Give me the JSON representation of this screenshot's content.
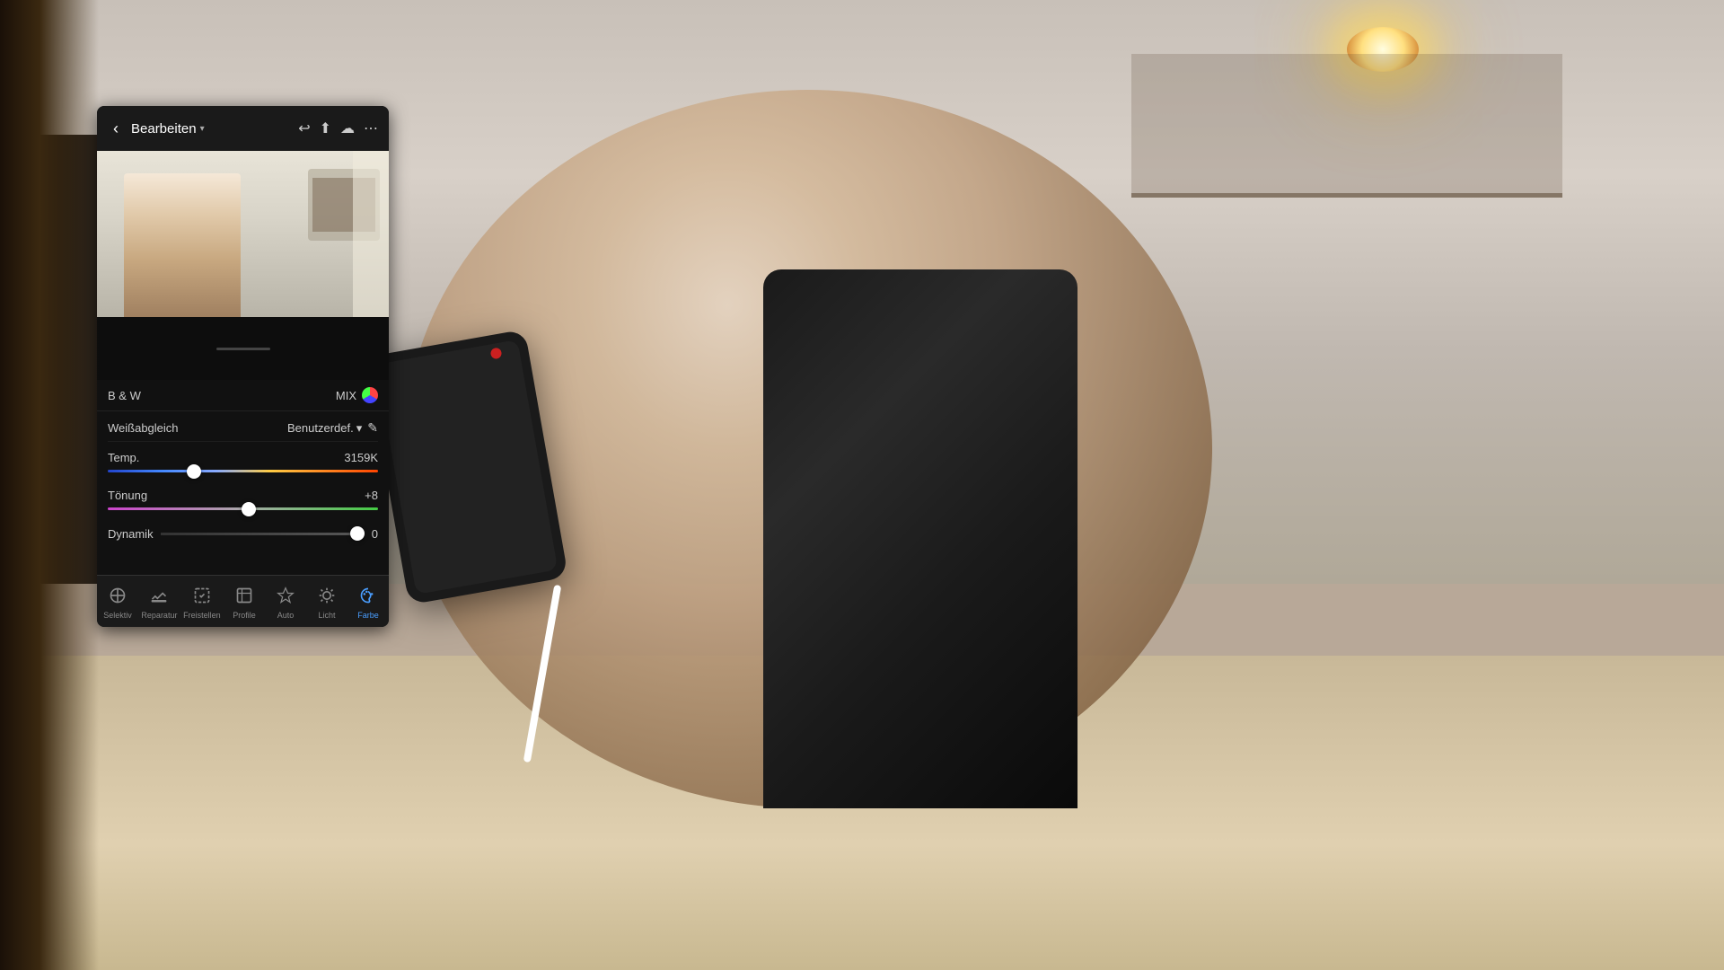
{
  "background": {
    "description": "Room scene with person holding phone"
  },
  "app": {
    "header": {
      "back_label": "‹",
      "title": "Bearbeiten",
      "chevron": "▾",
      "undo_icon": "↩",
      "export_icon": "⬆",
      "cloud_icon": "☁",
      "more_icon": "⋯"
    },
    "bw_section": {
      "bw_label": "B & W",
      "mix_label": "MIX"
    },
    "weissabgleich": {
      "label": "Weißabgleich",
      "value": "Benutzerdef.",
      "chevron": "▾"
    },
    "temp": {
      "label": "Temp.",
      "value": "3159K",
      "thumb_percent": 32
    },
    "tonung": {
      "label": "Tönung",
      "value": "+8",
      "thumb_percent": 52
    },
    "dynamik": {
      "label": "Dynamik",
      "value": "0"
    },
    "toolbar": {
      "items": [
        {
          "id": "selektiv",
          "label": "Selektiv",
          "active": false,
          "icon": "selektiv"
        },
        {
          "id": "reparatur",
          "label": "Reparatur",
          "active": false,
          "icon": "reparatur"
        },
        {
          "id": "freistellen",
          "label": "Freistellen",
          "active": false,
          "icon": "freistellen"
        },
        {
          "id": "profile",
          "label": "Profile",
          "active": false,
          "icon": "profile"
        },
        {
          "id": "auto",
          "label": "Auto",
          "active": false,
          "icon": "auto"
        },
        {
          "id": "licht",
          "label": "Licht",
          "active": false,
          "icon": "licht"
        },
        {
          "id": "farbe",
          "label": "Farbe",
          "active": true,
          "icon": "farbe"
        }
      ]
    }
  }
}
